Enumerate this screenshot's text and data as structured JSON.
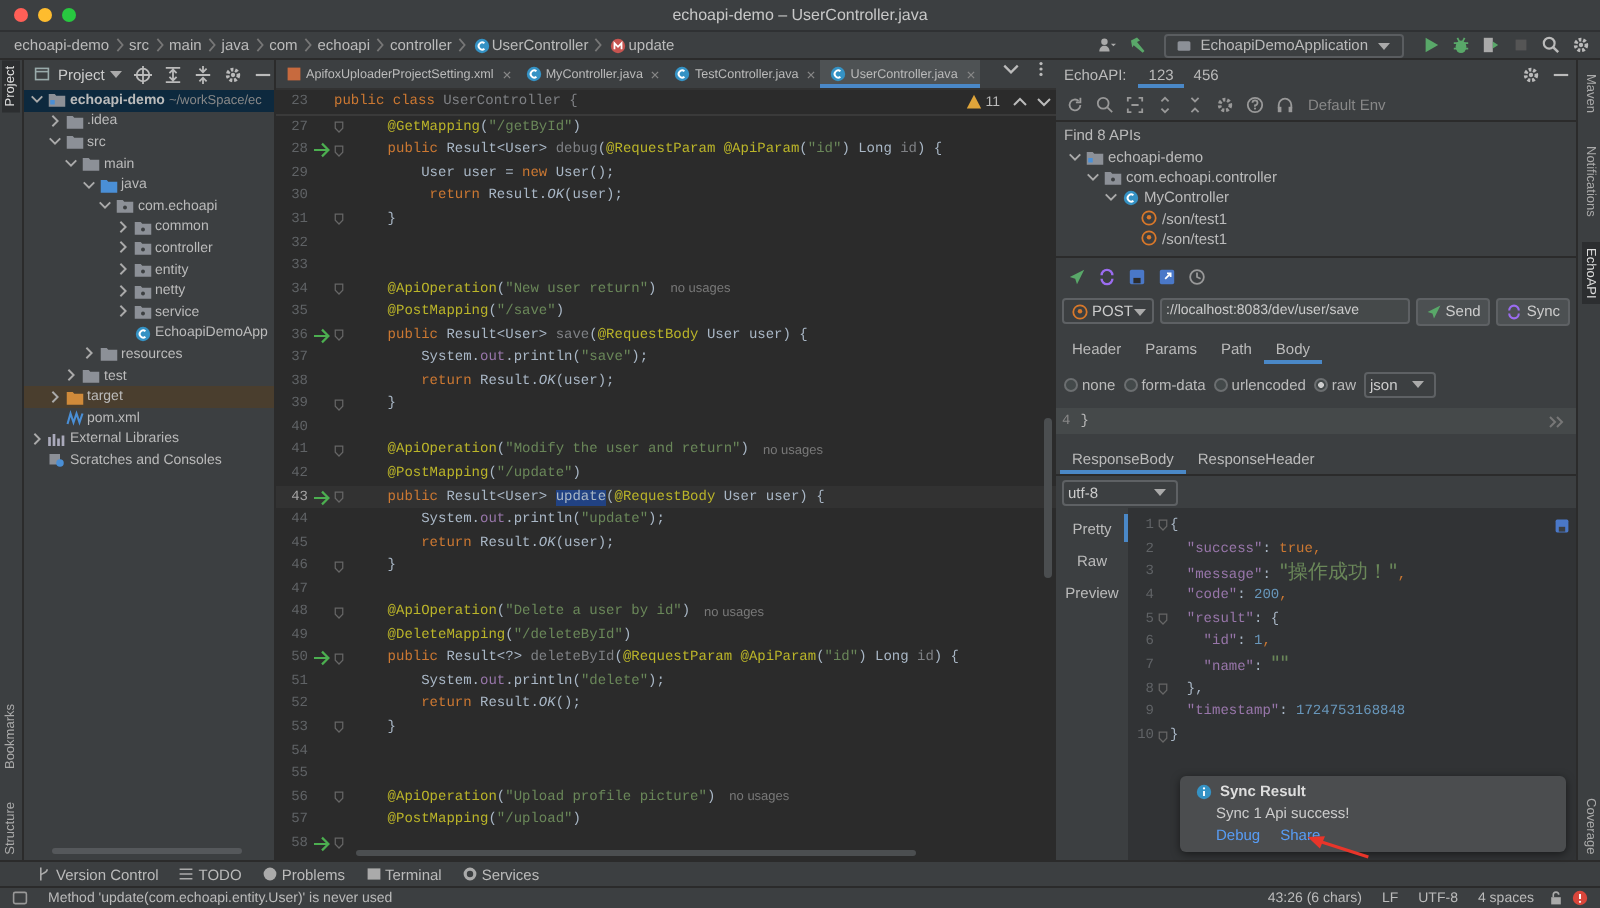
{
  "window": {
    "title": "echoapi-demo – UserController.java"
  },
  "breadcrumbs": [
    {
      "label": "echoapi-demo",
      "kind": "text"
    },
    {
      "label": "src",
      "kind": "text"
    },
    {
      "label": "main",
      "kind": "text"
    },
    {
      "label": "java",
      "kind": "text"
    },
    {
      "label": "com",
      "kind": "text"
    },
    {
      "label": "echoapi",
      "kind": "text"
    },
    {
      "label": "controller",
      "kind": "text"
    },
    {
      "label": "UserController",
      "kind": "class"
    },
    {
      "label": "update",
      "kind": "method"
    }
  ],
  "run_config": {
    "label": "EchoapiDemoApplication"
  },
  "left_strip": {
    "top": [
      {
        "label": "Project",
        "selected": true
      }
    ],
    "bottom": [
      {
        "label": "Bookmarks",
        "selected": false
      },
      {
        "label": "Structure",
        "selected": false
      }
    ]
  },
  "project_panel": {
    "title": "Project",
    "tree": [
      {
        "name": "echoapi-demo",
        "hint": "~/workSpace/ec",
        "kind": "module",
        "expanded": true,
        "selected": true,
        "children": [
          {
            "name": ".idea",
            "kind": "folder",
            "expanded": false,
            "selected": false
          },
          {
            "name": "src",
            "kind": "folder",
            "expanded": true,
            "selected": false,
            "children": [
              {
                "name": "main",
                "kind": "folder",
                "expanded": true,
                "selected": false,
                "children": [
                  {
                    "name": "java",
                    "kind": "source-folder",
                    "expanded": true,
                    "selected": false,
                    "children": [
                      {
                        "name": "com.echoapi",
                        "kind": "package",
                        "expanded": true,
                        "selected": false,
                        "children": [
                          {
                            "name": "common",
                            "kind": "package",
                            "expanded": false,
                            "selected": false
                          },
                          {
                            "name": "controller",
                            "kind": "package",
                            "expanded": false,
                            "selected": false
                          },
                          {
                            "name": "entity",
                            "kind": "package",
                            "expanded": false,
                            "selected": false
                          },
                          {
                            "name": "netty",
                            "kind": "package",
                            "expanded": false,
                            "selected": false
                          },
                          {
                            "name": "service",
                            "kind": "package",
                            "expanded": false,
                            "selected": false
                          },
                          {
                            "name": "EchoapiDemoApp",
                            "kind": "class",
                            "selected": false
                          }
                        ]
                      }
                    ]
                  },
                  {
                    "name": "resources",
                    "kind": "folder",
                    "expanded": false,
                    "selected": false
                  }
                ]
              },
              {
                "name": "test",
                "kind": "folder",
                "expanded": false,
                "selected": false
              }
            ]
          },
          {
            "name": "target",
            "kind": "excluded-folder",
            "expanded": false,
            "selected": false
          },
          {
            "name": "pom.xml",
            "kind": "maven-file",
            "selected": false
          }
        ]
      },
      {
        "name": "External Libraries",
        "kind": "libraries",
        "expanded": false,
        "selected": false
      },
      {
        "name": "Scratches and Consoles",
        "kind": "scratches",
        "selected": false
      }
    ]
  },
  "editor": {
    "tabs": [
      {
        "label": "ApifoxUploaderProjectSetting.xml",
        "kind": "xml",
        "selected": false
      },
      {
        "label": "MyController.java",
        "kind": "class",
        "selected": false
      },
      {
        "label": "TestController.java",
        "kind": "class",
        "selected": false
      },
      {
        "label": "UserController.java",
        "kind": "class",
        "selected": true
      }
    ],
    "warnings": "11",
    "sticky_line": {
      "number": "23",
      "tokens": [
        {
          "text": "public class ",
          "kind": "keyword"
        },
        {
          "text": "UserController {",
          "kind": "unused"
        }
      ]
    },
    "lines": [
      {
        "number": "27",
        "run": false,
        "fold": true,
        "current": false,
        "tokens": [
          {
            "text": "    @GetMapping",
            "kind": "annotation"
          },
          {
            "text": "(",
            "kind": "plain"
          },
          {
            "text": "\"/getById\"",
            "kind": "string"
          },
          {
            "text": ")",
            "kind": "plain"
          }
        ]
      },
      {
        "number": "28",
        "run": true,
        "fold": true,
        "current": false,
        "tokens": [
          {
            "text": "    public ",
            "kind": "keyword"
          },
          {
            "text": "Result<User> ",
            "kind": "plain"
          },
          {
            "text": "debug",
            "kind": "unused"
          },
          {
            "text": "(",
            "kind": "plain"
          },
          {
            "text": "@RequestParam @ApiParam",
            "kind": "annotation"
          },
          {
            "text": "(",
            "kind": "plain"
          },
          {
            "text": "\"id\"",
            "kind": "string"
          },
          {
            "text": ") Long ",
            "kind": "plain"
          },
          {
            "text": "id",
            "kind": "unused"
          },
          {
            "text": ") {",
            "kind": "plain"
          }
        ]
      },
      {
        "number": "29",
        "run": false,
        "fold": false,
        "current": false,
        "tokens": [
          {
            "text": "        User user = ",
            "kind": "plain"
          },
          {
            "text": "new ",
            "kind": "keyword"
          },
          {
            "text": "User();",
            "kind": "plain"
          }
        ]
      },
      {
        "number": "30",
        "run": false,
        "fold": false,
        "current": false,
        "tokens": [
          {
            "text": "         return ",
            "kind": "keyword"
          },
          {
            "text": "Result.",
            "kind": "plain"
          },
          {
            "text": "OK",
            "kind": "static"
          },
          {
            "text": "(user);",
            "kind": "plain"
          }
        ]
      },
      {
        "number": "31",
        "run": false,
        "fold": true,
        "current": false,
        "tokens": [
          {
            "text": "    }",
            "kind": "plain"
          }
        ]
      },
      {
        "number": "32",
        "run": false,
        "fold": false,
        "current": false
      },
      {
        "number": "33",
        "run": false,
        "fold": false,
        "current": false
      },
      {
        "number": "34",
        "run": false,
        "fold": true,
        "current": false,
        "tokens": [
          {
            "text": "    @ApiOperation",
            "kind": "annotation"
          },
          {
            "text": "(",
            "kind": "plain"
          },
          {
            "text": "\"New user return\"",
            "kind": "string"
          },
          {
            "text": ")",
            "kind": "plain"
          },
          {
            "text": "no usages",
            "kind": "hint"
          }
        ]
      },
      {
        "number": "35",
        "run": false,
        "fold": false,
        "current": false,
        "tokens": [
          {
            "text": "    @PostMapping",
            "kind": "annotation"
          },
          {
            "text": "(",
            "kind": "plain"
          },
          {
            "text": "\"/save\"",
            "kind": "string"
          },
          {
            "text": ")",
            "kind": "plain"
          }
        ]
      },
      {
        "number": "36",
        "run": true,
        "fold": true,
        "current": false,
        "tokens": [
          {
            "text": "    public ",
            "kind": "keyword"
          },
          {
            "text": "Result<User> ",
            "kind": "plain"
          },
          {
            "text": "save",
            "kind": "unused"
          },
          {
            "text": "(",
            "kind": "plain"
          },
          {
            "text": "@RequestBody ",
            "kind": "annotation"
          },
          {
            "text": "User user) {",
            "kind": "plain"
          }
        ]
      },
      {
        "number": "37",
        "run": false,
        "fold": false,
        "current": false,
        "tokens": [
          {
            "text": "        System.",
            "kind": "plain"
          },
          {
            "text": "out",
            "kind": "field"
          },
          {
            "text": ".println(",
            "kind": "plain"
          },
          {
            "text": "\"save\"",
            "kind": "string"
          },
          {
            "text": ");",
            "kind": "plain"
          }
        ]
      },
      {
        "number": "38",
        "run": false,
        "fold": false,
        "current": false,
        "tokens": [
          {
            "text": "        return ",
            "kind": "keyword"
          },
          {
            "text": "Result.",
            "kind": "plain"
          },
          {
            "text": "OK",
            "kind": "static"
          },
          {
            "text": "(user);",
            "kind": "plain"
          }
        ]
      },
      {
        "number": "39",
        "run": false,
        "fold": true,
        "current": false,
        "tokens": [
          {
            "text": "    }",
            "kind": "plain"
          }
        ]
      },
      {
        "number": "40",
        "run": false,
        "fold": false,
        "current": false
      },
      {
        "number": "41",
        "run": false,
        "fold": true,
        "current": false,
        "tokens": [
          {
            "text": "    @ApiOperation",
            "kind": "annotation"
          },
          {
            "text": "(",
            "kind": "plain"
          },
          {
            "text": "\"Modify the user and return\"",
            "kind": "string"
          },
          {
            "text": ")",
            "kind": "plain"
          },
          {
            "text": "no usages",
            "kind": "hint"
          }
        ]
      },
      {
        "number": "42",
        "run": false,
        "fold": false,
        "current": false,
        "tokens": [
          {
            "text": "    @PostMapping",
            "kind": "annotation"
          },
          {
            "text": "(",
            "kind": "plain"
          },
          {
            "text": "\"/update\"",
            "kind": "string"
          },
          {
            "text": ")",
            "kind": "plain"
          }
        ]
      },
      {
        "number": "43",
        "run": true,
        "fold": true,
        "current": true,
        "tokens": [
          {
            "text": "    public ",
            "kind": "keyword"
          },
          {
            "text": "Result<User> ",
            "kind": "plain"
          },
          {
            "text": "update",
            "kind": "match"
          },
          {
            "text": "(",
            "kind": "plain"
          },
          {
            "text": "@RequestBody ",
            "kind": "annotation"
          },
          {
            "text": "User user) {",
            "kind": "plain"
          }
        ]
      },
      {
        "number": "44",
        "run": false,
        "fold": false,
        "current": false,
        "tokens": [
          {
            "text": "        System.",
            "kind": "plain"
          },
          {
            "text": "out",
            "kind": "field"
          },
          {
            "text": ".println(",
            "kind": "plain"
          },
          {
            "text": "\"update\"",
            "kind": "string"
          },
          {
            "text": ");",
            "kind": "plain"
          }
        ]
      },
      {
        "number": "45",
        "run": false,
        "fold": false,
        "current": false,
        "tokens": [
          {
            "text": "        return ",
            "kind": "keyword"
          },
          {
            "text": "Result.",
            "kind": "plain"
          },
          {
            "text": "OK",
            "kind": "static"
          },
          {
            "text": "(user);",
            "kind": "plain"
          }
        ]
      },
      {
        "number": "46",
        "run": false,
        "fold": true,
        "current": false,
        "tokens": [
          {
            "text": "    }",
            "kind": "plain"
          }
        ]
      },
      {
        "number": "47",
        "run": false,
        "fold": false,
        "current": false
      },
      {
        "number": "48",
        "run": false,
        "fold": true,
        "current": false,
        "tokens": [
          {
            "text": "    @ApiOperation",
            "kind": "annotation"
          },
          {
            "text": "(",
            "kind": "plain"
          },
          {
            "text": "\"Delete a user by id\"",
            "kind": "string"
          },
          {
            "text": ")",
            "kind": "plain"
          },
          {
            "text": "no usages",
            "kind": "hint"
          }
        ]
      },
      {
        "number": "49",
        "run": false,
        "fold": false,
        "current": false,
        "tokens": [
          {
            "text": "    @DeleteMapping",
            "kind": "annotation"
          },
          {
            "text": "(",
            "kind": "plain"
          },
          {
            "text": "\"/deleteById\"",
            "kind": "string"
          },
          {
            "text": ")",
            "kind": "plain"
          }
        ]
      },
      {
        "number": "50",
        "run": true,
        "fold": true,
        "current": false,
        "tokens": [
          {
            "text": "    public ",
            "kind": "keyword"
          },
          {
            "text": "Result<?> ",
            "kind": "plain"
          },
          {
            "text": "deleteById",
            "kind": "unused"
          },
          {
            "text": "(",
            "kind": "plain"
          },
          {
            "text": "@RequestParam @ApiParam",
            "kind": "annotation"
          },
          {
            "text": "(",
            "kind": "plain"
          },
          {
            "text": "\"id\"",
            "kind": "string"
          },
          {
            "text": ") Long ",
            "kind": "plain"
          },
          {
            "text": "id",
            "kind": "unused"
          },
          {
            "text": ") {",
            "kind": "plain"
          }
        ]
      },
      {
        "number": "51",
        "run": false,
        "fold": false,
        "current": false,
        "tokens": [
          {
            "text": "        System.",
            "kind": "plain"
          },
          {
            "text": "out",
            "kind": "field"
          },
          {
            "text": ".println(",
            "kind": "plain"
          },
          {
            "text": "\"delete\"",
            "kind": "string"
          },
          {
            "text": ");",
            "kind": "plain"
          }
        ]
      },
      {
        "number": "52",
        "run": false,
        "fold": false,
        "current": false,
        "tokens": [
          {
            "text": "        return ",
            "kind": "keyword"
          },
          {
            "text": "Result.",
            "kind": "plain"
          },
          {
            "text": "OK",
            "kind": "static"
          },
          {
            "text": "();",
            "kind": "plain"
          }
        ]
      },
      {
        "number": "53",
        "run": false,
        "fold": true,
        "current": false,
        "tokens": [
          {
            "text": "    }",
            "kind": "plain"
          }
        ]
      },
      {
        "number": "54",
        "run": false,
        "fold": false,
        "current": false
      },
      {
        "number": "55",
        "run": false,
        "fold": false,
        "current": false
      },
      {
        "number": "56",
        "run": false,
        "fold": true,
        "current": false,
        "tokens": [
          {
            "text": "    @ApiOperation",
            "kind": "annotation"
          },
          {
            "text": "(",
            "kind": "plain"
          },
          {
            "text": "\"Upload profile picture\"",
            "kind": "string"
          },
          {
            "text": ")",
            "kind": "plain"
          },
          {
            "text": "no usages",
            "kind": "hint"
          }
        ]
      },
      {
        "number": "57",
        "run": false,
        "fold": false,
        "current": false,
        "tokens": [
          {
            "text": "    @PostMapping",
            "kind": "annotation"
          },
          {
            "text": "(",
            "kind": "plain"
          },
          {
            "text": "\"/upload\"",
            "kind": "string"
          },
          {
            "text": ")",
            "kind": "plain"
          }
        ]
      },
      {
        "number": "58",
        "run": true,
        "fold": true,
        "current": false
      }
    ]
  },
  "echoapi": {
    "label": "EchoAPI:",
    "tabs": [
      {
        "label": "123",
        "selected": true
      },
      {
        "label": "456",
        "selected": false
      }
    ],
    "env": "Default Env",
    "found": "Find 8 APIs",
    "tree": [
      {
        "name": "echoapi-demo",
        "kind": "module",
        "expanded": true,
        "children": [
          {
            "name": "com.echoapi.controller",
            "kind": "package",
            "expanded": true,
            "children": [
              {
                "name": "MyController",
                "kind": "class",
                "expanded": true,
                "children": [
                  {
                    "name": "/son/test1",
                    "kind": "endpoint"
                  },
                  {
                    "name": "/son/test1",
                    "kind": "endpoint"
                  }
                ]
              }
            ]
          }
        ]
      }
    ],
    "request": {
      "method": "POST",
      "url": "://localhost:8083/dev/user/save",
      "buttons": [
        {
          "label": "Send",
          "kind": "send"
        },
        {
          "label": "Sync",
          "kind": "sync"
        }
      ]
    },
    "request_tabs": [
      {
        "label": "Header",
        "selected": false
      },
      {
        "label": "Params",
        "selected": false
      },
      {
        "label": "Path",
        "selected": false
      },
      {
        "label": "Body",
        "selected": true
      }
    ],
    "body_types": [
      {
        "label": "none",
        "selected": false
      },
      {
        "label": "form-data",
        "selected": false
      },
      {
        "label": "urlencoded",
        "selected": false
      },
      {
        "label": "raw",
        "selected": true
      }
    ],
    "body_format": "json",
    "body_lines": [
      {
        "number": "4",
        "text": "}"
      }
    ],
    "response_tabs": [
      {
        "label": "ResponseBody",
        "selected": true
      },
      {
        "label": "ResponseHeader",
        "selected": false
      }
    ],
    "encoding": "utf-8",
    "view_tabs": [
      {
        "label": "Pretty",
        "selected": true
      },
      {
        "label": "Raw",
        "selected": false
      },
      {
        "label": "Preview",
        "selected": false
      }
    ],
    "response_lines": [
      {
        "number": "1",
        "fold": true,
        "tokens": [
          {
            "text": "{",
            "kind": "punct"
          }
        ]
      },
      {
        "number": "2",
        "fold": false,
        "tokens": [
          {
            "text": "  \"success\"",
            "kind": "key"
          },
          {
            "text": ": ",
            "kind": "punct"
          },
          {
            "text": "true",
            "kind": "bool"
          },
          {
            "text": ",",
            "kind": "bool"
          }
        ]
      },
      {
        "number": "3",
        "fold": false,
        "tokens": [
          {
            "text": "  \"message\"",
            "kind": "key"
          },
          {
            "text": ": ",
            "kind": "punct"
          },
          {
            "text": "\"操作成功！\"",
            "kind": "string"
          },
          {
            "text": ",",
            "kind": "bool"
          }
        ]
      },
      {
        "number": "4",
        "fold": false,
        "tokens": [
          {
            "text": "  \"code\"",
            "kind": "key"
          },
          {
            "text": ": ",
            "kind": "punct"
          },
          {
            "text": "200",
            "kind": "number"
          },
          {
            "text": ",",
            "kind": "bool"
          }
        ]
      },
      {
        "number": "5",
        "fold": true,
        "tokens": [
          {
            "text": "  \"result\"",
            "kind": "key"
          },
          {
            "text": ": {",
            "kind": "punct"
          }
        ]
      },
      {
        "number": "6",
        "fold": false,
        "tokens": [
          {
            "text": "    \"id\"",
            "kind": "key"
          },
          {
            "text": ": ",
            "kind": "punct"
          },
          {
            "text": "1",
            "kind": "number"
          },
          {
            "text": ",",
            "kind": "bool"
          }
        ]
      },
      {
        "number": "7",
        "fold": false,
        "tokens": [
          {
            "text": "    \"name\"",
            "kind": "key"
          },
          {
            "text": ": ",
            "kind": "punct"
          },
          {
            "text": "\"\"",
            "kind": "string"
          }
        ]
      },
      {
        "number": "8",
        "fold": true,
        "tokens": [
          {
            "text": "  },",
            "kind": "punct"
          }
        ]
      },
      {
        "number": "9",
        "fold": false,
        "tokens": [
          {
            "text": "  \"timestamp\"",
            "kind": "key"
          },
          {
            "text": ": ",
            "kind": "punct"
          },
          {
            "text": "1724753168848",
            "kind": "number"
          }
        ]
      },
      {
        "number": "10",
        "fold": true,
        "tokens": [
          {
            "text": "}",
            "kind": "punct"
          }
        ]
      }
    ]
  },
  "notification": {
    "title": "Sync Result",
    "message": "Sync 1 Api success!",
    "links": [
      "Debug",
      "Share"
    ]
  },
  "right_strip": {
    "top": [
      {
        "label": "Maven",
        "selected": false
      },
      {
        "label": "Notifications",
        "selected": false
      },
      {
        "label": "EchoAPI",
        "selected": true
      }
    ],
    "bottom": [
      {
        "label": "Coverage",
        "selected": false
      }
    ]
  },
  "tool_windows": [
    {
      "label": "Version Control",
      "kind": "vcs"
    },
    {
      "label": "TODO",
      "kind": "todo"
    },
    {
      "label": "Problems",
      "kind": "problems"
    },
    {
      "label": "Terminal",
      "kind": "terminal"
    },
    {
      "label": "Services",
      "kind": "services"
    }
  ],
  "status_bar": {
    "message": "Method 'update(com.echoapi.entity.User)' is never used",
    "items": [
      "43:26 (6 chars)",
      "LF",
      "UTF-8",
      "4 spaces"
    ]
  }
}
